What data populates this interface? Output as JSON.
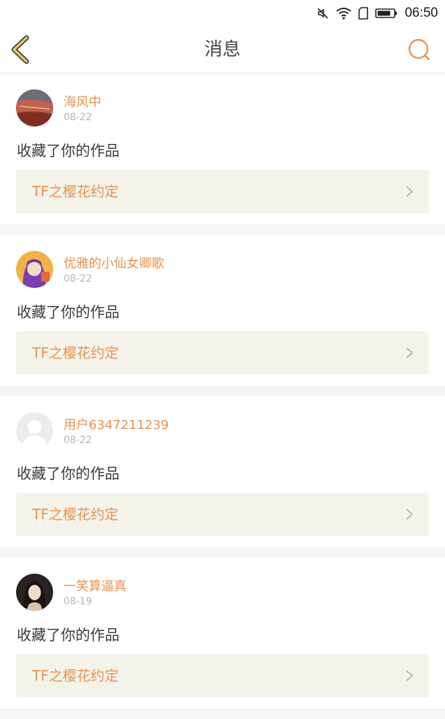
{
  "status_bar": {
    "time": "06:50",
    "icons": [
      "mute-icon",
      "wifi-icon",
      "sim-icon",
      "battery-icon"
    ]
  },
  "header": {
    "title": "消息",
    "back_icon": "back-chevron-icon",
    "search_icon": "search-icon"
  },
  "colors": {
    "accent": "#e8924f",
    "back_icon": "#e6c86a",
    "card_link_bg": "#f4f3ea"
  },
  "messages": [
    {
      "username": "海风中",
      "date": "08-22",
      "action": "收藏了你的作品",
      "work_title": "TF之樱花约定"
    },
    {
      "username": "优雅的小仙女卿歌",
      "date": "08-22",
      "action": "收藏了你的作品",
      "work_title": "TF之樱花约定"
    },
    {
      "username": "用户6347211239",
      "date": "08-22",
      "action": "收藏了你的作品",
      "work_title": "TF之樱花约定"
    },
    {
      "username": "一笑算逼真",
      "date": "08-19",
      "action": "收藏了你的作品",
      "work_title": "TF之樱花约定"
    }
  ]
}
